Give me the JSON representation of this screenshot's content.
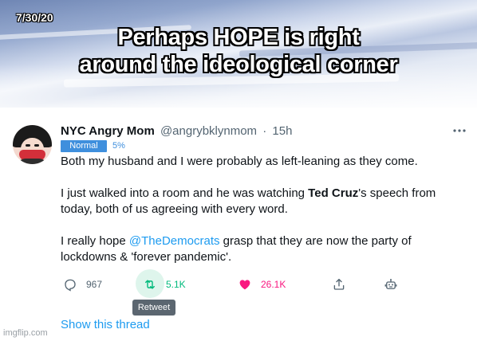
{
  "meme": {
    "date": "7/30/20",
    "headline_line1": "Perhaps HOPE is right",
    "headline_line2": "around the ideological corner"
  },
  "tweet": {
    "display_name": "NYC Angry Mom",
    "handle": "@angrybklynmom",
    "separator": "·",
    "time": "15h",
    "more_icon": "more-horizontal-icon",
    "badge": {
      "label": "Normal",
      "percent": "5%",
      "color": "#3f8fdd"
    },
    "body": {
      "p1": "Both my husband and I were probably as left-leaning as they come.",
      "p2_before": "I just walked into a room and he was watching ",
      "p2_bold": "Ted Cruz",
      "p2_after": "'s speech from today, both of us agreeing with every word.",
      "p3_before": "I really hope ",
      "p3_mention": "@TheDemocrats",
      "p3_after": " grasp that they are now the party of lockdowns & 'forever pandemic'."
    },
    "actions": {
      "reply": {
        "icon": "reply-icon",
        "count": "967"
      },
      "retweet": {
        "icon": "retweet-icon",
        "count": "5.1K",
        "tooltip": "Retweet",
        "color": "#00ba7c"
      },
      "like": {
        "icon": "heart-icon",
        "count": "26.1K",
        "color": "#f91880"
      },
      "share": {
        "icon": "share-icon"
      },
      "extension": {
        "icon": "robot-icon"
      }
    },
    "show_thread": "Show this thread",
    "link_color": "#1d9bf0"
  },
  "watermark": "imgflip.com"
}
